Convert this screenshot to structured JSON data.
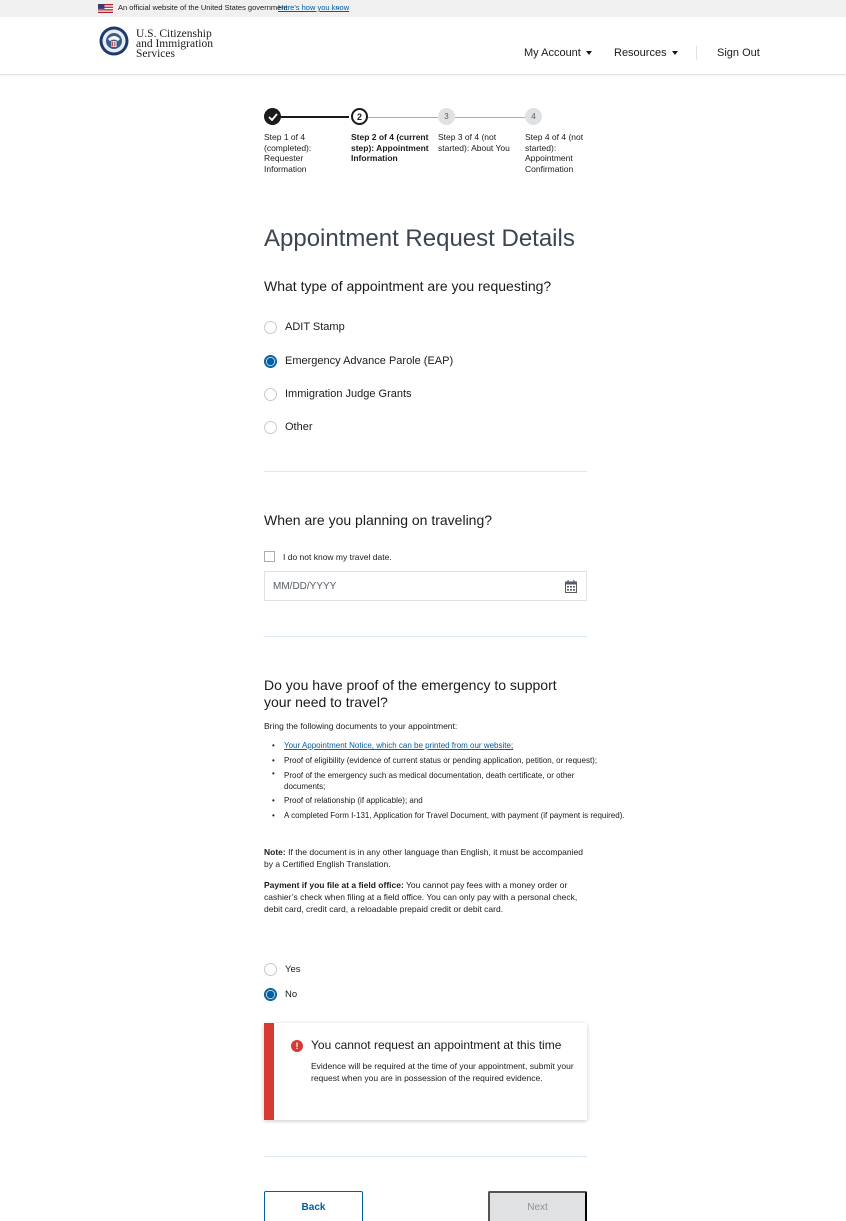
{
  "gov_banner": {
    "text": "An official website of the United States government",
    "link": "Here’s how you know",
    "caret": "⌄"
  },
  "header": {
    "agency_lines": [
      "U.S. Citizenship",
      "and Immigration",
      "Services"
    ],
    "nav": {
      "my_account": "My Account",
      "resources": "Resources",
      "sign_out": "Sign Out"
    }
  },
  "stepper": {
    "steps": [
      {
        "number": "",
        "status": "completed",
        "label": "Step 1 of 4 (completed): Requester Information"
      },
      {
        "number": "2",
        "status": "current",
        "label": "Step 2 of 4 (current step): Appointment Information"
      },
      {
        "number": "3",
        "status": "not-started",
        "label": "Step 3 of 4 (not started): About You"
      },
      {
        "number": "4",
        "status": "not-started",
        "label": "Step 4 of 4 (not started): Appointment Confirmation"
      }
    ]
  },
  "page_title": "Appointment Request Details",
  "appointment_type": {
    "question": "What type of appointment are you requesting?",
    "options": [
      "ADIT Stamp",
      "Emergency Advance Parole (EAP)",
      "Immigration Judge Grants",
      "Other"
    ],
    "selected": "Emergency Advance Parole (EAP)"
  },
  "travel": {
    "question": "When are you planning on traveling?",
    "unknown_date_label": "I do not know my travel date.",
    "unknown_date_checked": false,
    "date_placeholder": "MM/DD/YYYY"
  },
  "proof": {
    "question": "Do you have proof of the emergency to support your need to travel?",
    "intro": "Bring the following documents to your appointment:",
    "documents": [
      "Your Appointment Notice, which can be printed from our website;",
      "Proof of eligibility (evidence of current status or pending application, petition, or request);",
      "Proof of the emergency such as medical documentation, death certificate, or other documents;",
      "Proof of relationship (if applicable); and",
      "A completed Form I-131, Application for Travel Document, with payment (if payment is required)."
    ],
    "note_label": "Note:",
    "note_text": "If the document is in any other language than English, it must be accompanied by a Certified English Translation.",
    "payment_label": "Payment if you file at a field office:",
    "payment_text": "You cannot pay fees with a money order or cashier’s check when filing at a field office. You can only pay with a personal check, debit card, credit card, a reloadable prepaid credit or debit card.",
    "options": [
      "Yes",
      "No"
    ],
    "selected": "No"
  },
  "alert": {
    "icon": "!",
    "heading": "You cannot request an appointment at this time",
    "body": "Evidence will be required at the time of your appointment, submit your request when you are in possession of the required evidence."
  },
  "buttons": {
    "back": "Back",
    "next": "Next"
  },
  "colors": {
    "primary": "#005ea2",
    "error": "#d83933",
    "disabled_bg": "#dfe1e2"
  }
}
